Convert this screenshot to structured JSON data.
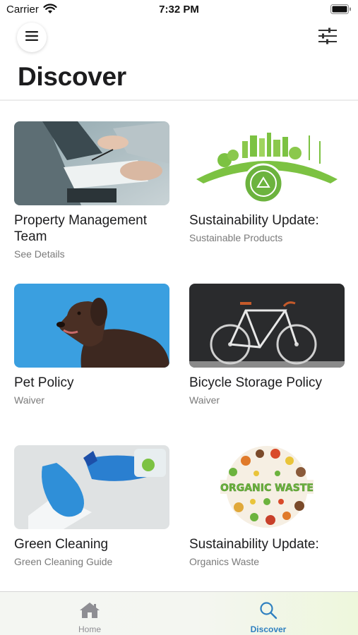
{
  "status_bar": {
    "carrier": "Carrier",
    "time": "7:32 PM"
  },
  "header": {
    "title": "Discover",
    "menu_icon": "hamburger-icon",
    "filter_icon": "sliders-icon"
  },
  "cards": [
    {
      "title": "Property Management Team",
      "subtitle": "See Details",
      "image": "meeting-photo"
    },
    {
      "title": "Sustainability Update:",
      "subtitle": "Sustainable Products",
      "image": "green-city-illustration"
    },
    {
      "title": "Pet Policy",
      "subtitle": "Waiver",
      "image": "dog-photo"
    },
    {
      "title": "Bicycle Storage Policy",
      "subtitle": "Waiver",
      "image": "bicycle-photo"
    },
    {
      "title": "Green Cleaning",
      "subtitle": "Green Cleaning Guide",
      "image": "cleaning-photo"
    },
    {
      "title": "Sustainability Update:",
      "subtitle": "Organics Waste",
      "image": "organic-waste-illustration",
      "image_text": "ORGANIC WASTE"
    }
  ],
  "tab_bar": {
    "tabs": [
      {
        "label": "Home",
        "icon": "house-icon",
        "active": false
      },
      {
        "label": "Discover",
        "icon": "search-icon",
        "active": true
      }
    ],
    "active_color": "#2f80c0",
    "inactive_color": "#8e8e93"
  }
}
